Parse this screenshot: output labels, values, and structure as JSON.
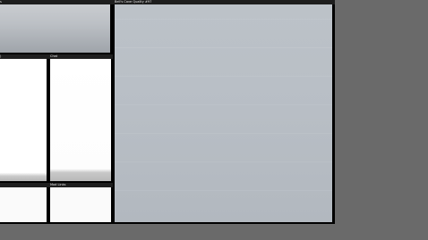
{
  "panels": {
    "top_left": {
      "title": "s"
    },
    "left_middle": {
      "title": ")"
    },
    "chat": {
      "title": "Chat"
    },
    "bottom_left": {
      "title": ""
    },
    "mod_links": {
      "title": "Mod Links"
    },
    "main": {
      "title": "Bell's Cave Quality #97"
    }
  },
  "colors": {
    "desktop": "#6a6a6a",
    "panel_frame": "#000000",
    "titlebar": "#1e1e1e",
    "main_body": "#b8bec5"
  }
}
